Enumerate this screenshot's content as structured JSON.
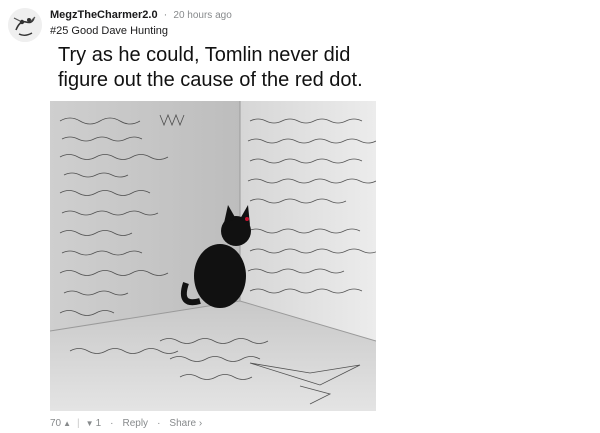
{
  "post": {
    "username": "MegzTheCharmer2.0",
    "timestamp": "20 hours ago",
    "subtitle": "#25 Good Dave Hunting",
    "caption": "Try as he could, Tomlin never did figure out the cause of the red dot."
  },
  "actions": {
    "score": "70",
    "down_count": "1",
    "reply_label": "Reply",
    "share_label": "Share",
    "share_chevron": "›"
  },
  "icons": {
    "avatar": "doodle-avatar",
    "upvote": "chevron-up-icon",
    "downvote": "chevron-down-icon"
  },
  "colors": {
    "text": "#1a1a1b",
    "muted": "#878a8c"
  }
}
